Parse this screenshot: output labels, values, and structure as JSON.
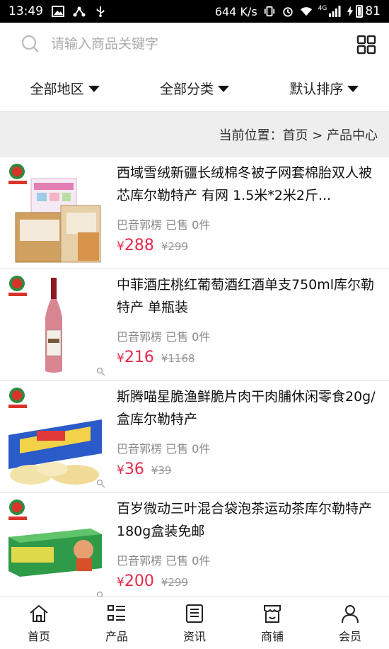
{
  "status_bar": {
    "time": "13:49",
    "net_speed": "644 K/s",
    "network": "4G",
    "battery": "81"
  },
  "search": {
    "placeholder": "请输入商品关键字"
  },
  "filters": [
    {
      "label": "全部地区"
    },
    {
      "label": "全部分类"
    },
    {
      "label": "默认排序"
    }
  ],
  "breadcrumb": {
    "text": "当前位置：首页 > 产品中心"
  },
  "products": [
    {
      "title": "西域雪绒新疆长绒棉冬被子网套棉胎双人被芯库尔勒特产 有网 1.5米*2米2斤...",
      "meta": "巴音郭楞 已售 0件",
      "price_symbol": "¥",
      "price": "288",
      "old_price": "¥299"
    },
    {
      "title": "中菲酒庄桃红葡萄酒红酒单支750ml库尔勒特产 单瓶装",
      "meta": "巴音郭楞 已售 0件",
      "price_symbol": "¥",
      "price": "216",
      "old_price": "¥1168"
    },
    {
      "title": "斯腾喵星脆渔鲜脆片肉干肉脯休闲零食20g/盒库尔勒特产",
      "meta": "巴音郭楞 已售 0件",
      "price_symbol": "¥",
      "price": "36",
      "old_price": "¥39"
    },
    {
      "title": "百岁微动三叶混合袋泡茶运动茶库尔勒特产180g盒装免邮",
      "meta": "巴音郭楞 已售 0件",
      "price_symbol": "¥",
      "price": "200",
      "old_price": "¥299"
    }
  ],
  "bottom_nav": [
    {
      "label": "首页",
      "icon": "home-icon"
    },
    {
      "label": "产品",
      "icon": "product-list-icon"
    },
    {
      "label": "资讯",
      "icon": "news-icon"
    },
    {
      "label": "商铺",
      "icon": "shop-icon"
    },
    {
      "label": "会员",
      "icon": "user-icon"
    }
  ],
  "colors": {
    "price": "#e8294a",
    "breadcrumb_bg": "#eeeeee"
  }
}
